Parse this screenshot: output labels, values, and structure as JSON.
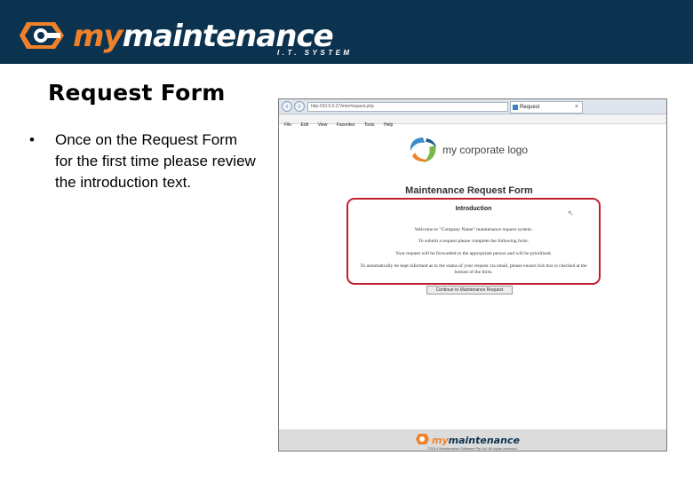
{
  "brand": {
    "my": "my",
    "main": "maintenance",
    "tagline": "I.T. SYSTEM",
    "accent_color": "#f0812a",
    "header_color": "#0b3350"
  },
  "slide": {
    "title": "Request Form",
    "bullets": [
      "Once on the Request Form for the first time please review the introduction text."
    ]
  },
  "screenshot": {
    "browser": {
      "address": "http://10.0.0.27/mm/request.php",
      "tab_label": "Request",
      "tab_close": "×",
      "menu": [
        "File",
        "Edit",
        "View",
        "Favorites",
        "Tools",
        "Help"
      ],
      "back_icon": "back-arrow-icon",
      "forward_icon": "forward-arrow-icon"
    },
    "corp_logo_text": "my corporate logo",
    "form_title": "Maintenance Request Form",
    "intro": {
      "heading": "Introduction",
      "lines": [
        "Welcome to \"Company Name\" maintenance request system.",
        "To submit a request please complete the following form.",
        "Your request will be forwarded to the appropriate person and will be prioritised.",
        "To automatically be kept informed as to the status of your request via email, please ensure tick box is checked at the bottom of the form."
      ],
      "highlight_color": "#c0202e"
    },
    "continue_button": "Continue to Maintenance Request",
    "footer": {
      "brand_my": "my",
      "brand_main": "maintenance",
      "copyright": "©2014 Maintenance Software Pty Ltd. All rights reserved."
    }
  }
}
